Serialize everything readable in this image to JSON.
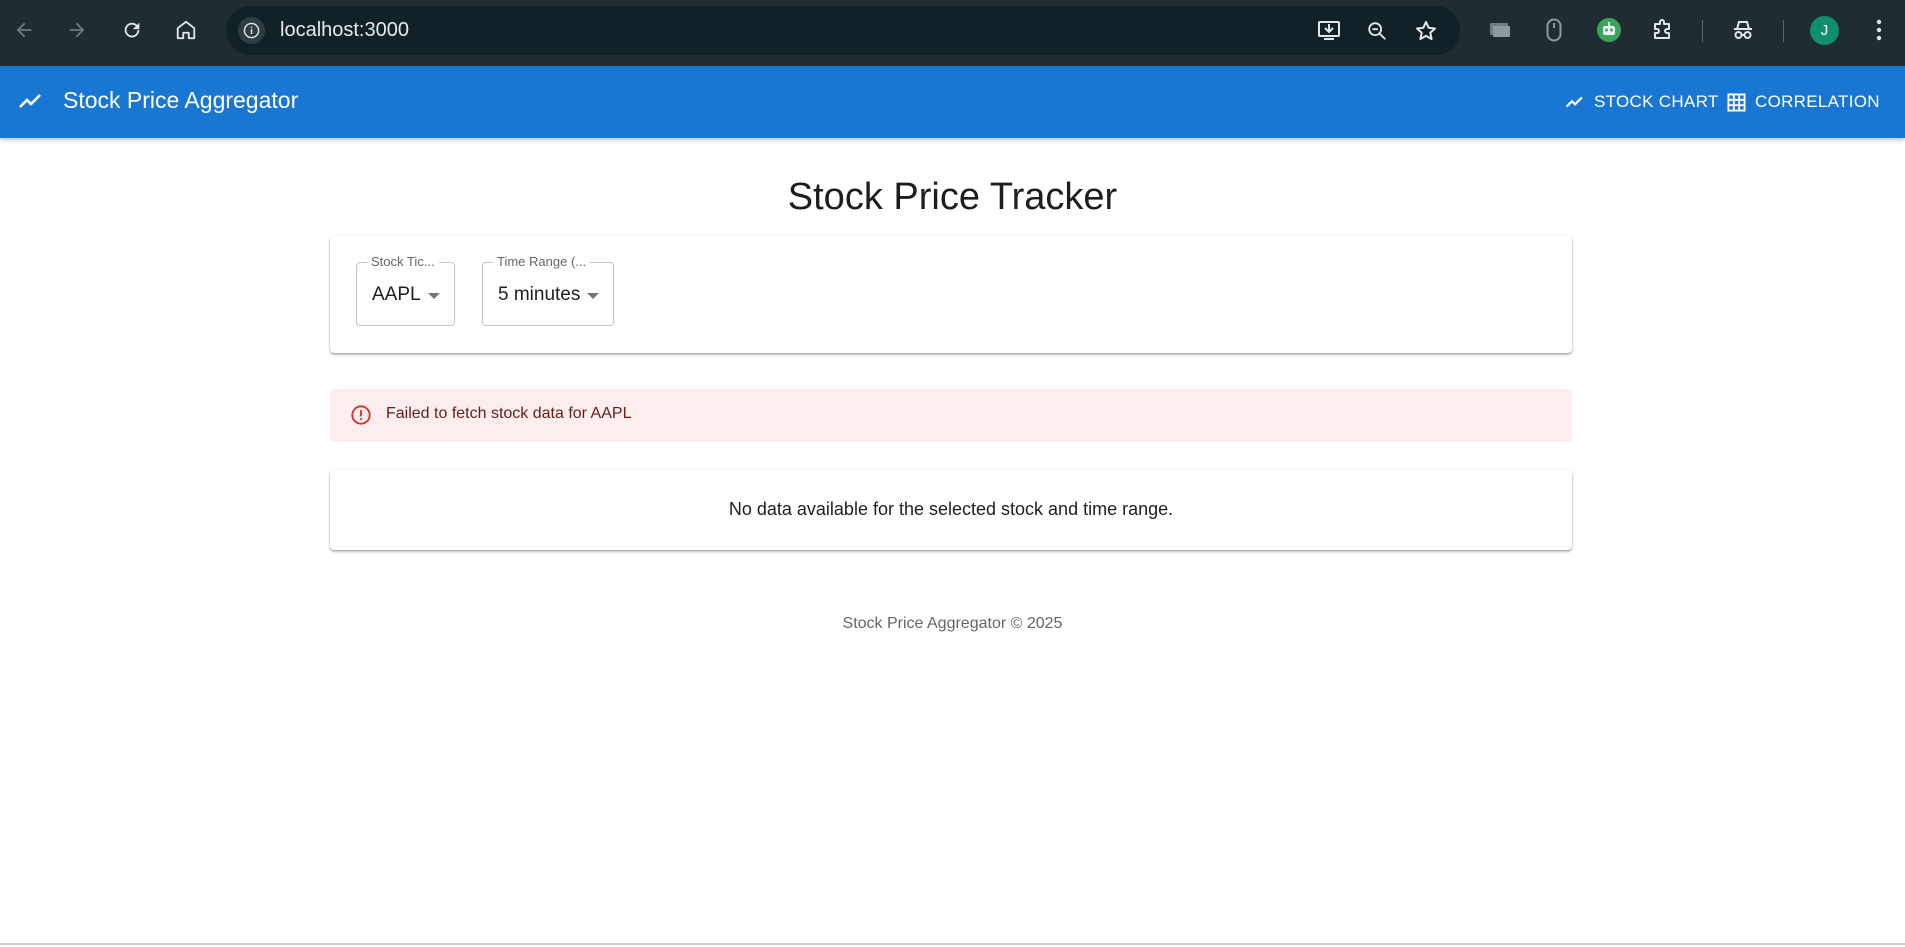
{
  "browser": {
    "url": "localhost:3000",
    "profile_initial": "J"
  },
  "appbar": {
    "title": "Stock Price Aggregator",
    "nav": [
      {
        "label": "STOCK CHART",
        "icon": "trending-up-icon"
      },
      {
        "label": "CORRELATION",
        "icon": "grid-icon"
      }
    ]
  },
  "main": {
    "title": "Stock Price Tracker",
    "controls": {
      "ticker": {
        "label": "Stock Tic...",
        "value": "AAPL"
      },
      "time_range": {
        "label": "Time Range (...",
        "value": "5 minutes"
      }
    },
    "error": "Failed to fetch stock data for AAPL",
    "empty_message": "No data available for the selected stock and time range."
  },
  "footer": "Stock Price Aggregator © 2025",
  "colors": {
    "appbar": "#1976d2",
    "error_bg": "#fdeded",
    "error_icon": "#d32f2f",
    "chrome_bg": "#1f2d33"
  }
}
